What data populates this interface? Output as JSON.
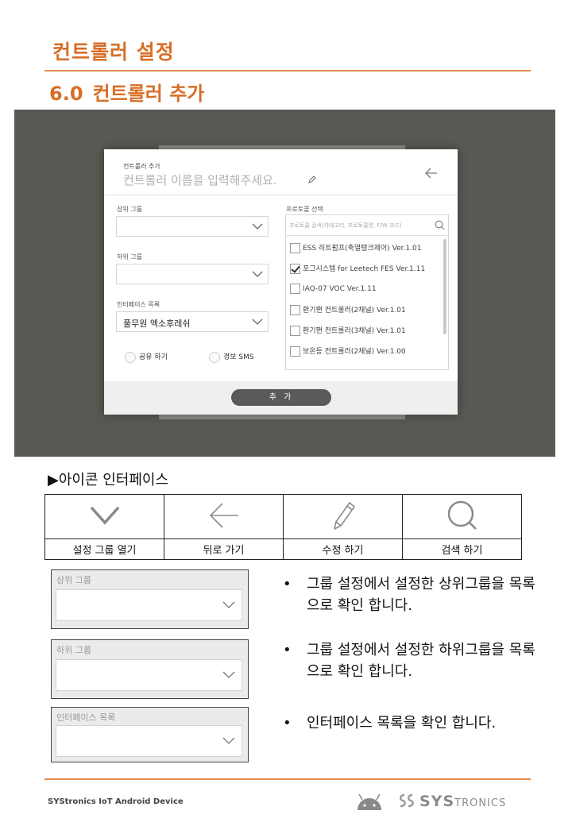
{
  "header": {
    "title": "컨트롤러 설정",
    "section_number": "6.0",
    "section_title": "컨트롤러 추가"
  },
  "dialog": {
    "small_title": "컨트롤러 추가",
    "name_placeholder": "컨트롤러 이름을 입력해주세요.",
    "upper_group_label": "상위 그룹",
    "lower_group_label": "하위 그룹",
    "interface_label": "인터페이스 목록",
    "interface_value": "풀무원 엑소후레쉬",
    "share_label": "공유 하기",
    "alarm_label": "경보 SMS",
    "protocol_label": "프로토콜 선택",
    "protocol_search_placeholder": "프로토콜 검색(카테고리, 프로토콜명, F/W 코드)",
    "protocols": [
      {
        "label": "ESS 히트펌프(축열탱크제어) Ver.1.01",
        "checked": false
      },
      {
        "label": "포그시스템 for Leetech FES Ver.1.11",
        "checked": true
      },
      {
        "label": "IAQ-07 VOC Ver.1.11",
        "checked": false
      },
      {
        "label": "환기팬 컨트롤러(2채널) Ver.1.01",
        "checked": false
      },
      {
        "label": "환기팬 컨트롤러(3채널) Ver.1.01",
        "checked": false
      },
      {
        "label": "보온등 컨트롤러(2채널) Ver.1.00",
        "checked": false
      }
    ],
    "add_button": "추 가"
  },
  "icon_section": {
    "heading": "▶아이콘 인터페이스",
    "icons": [
      {
        "icon": "chevron-down-icon",
        "name": "설정 그룹 열기"
      },
      {
        "icon": "arrow-left-icon",
        "name": "뒤로 가기"
      },
      {
        "icon": "pencil-icon",
        "name": "수정 하기"
      },
      {
        "icon": "search-icon",
        "name": "검색 하기"
      }
    ]
  },
  "panels": [
    {
      "label": "상위 그룹",
      "description": "그룹 설정에서 설정한 상위그룹을 목록으로 확인 합니다."
    },
    {
      "label": "하위 그룹",
      "description": "그룹 설정에서 설정한 하위그룹을 목록으로 확인 합니다."
    },
    {
      "label": "인터페이스 목록",
      "description": "인터페이스 목록을 확인 합니다."
    }
  ],
  "bullet_symbol": "•",
  "footer": {
    "text": "SYStronics IoT Android Device",
    "brand_big": "SYS",
    "brand_small": "TRONICS"
  },
  "colors": {
    "accent": "#d86e27",
    "rule": "#e28a4d",
    "frame": "#595954"
  }
}
